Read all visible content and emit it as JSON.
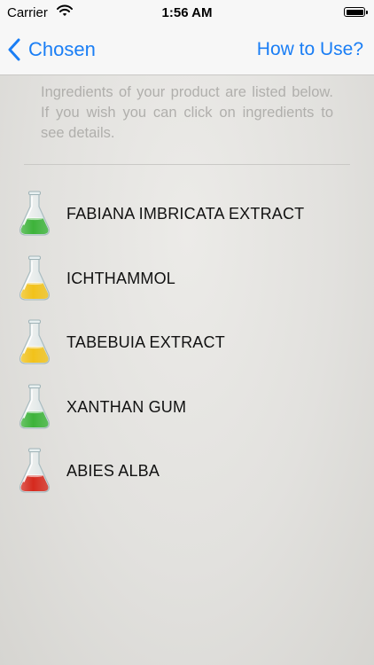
{
  "status_bar": {
    "carrier": "Carrier",
    "time": "1:56 AM",
    "wifi_icon": "wifi-icon",
    "battery_icon": "battery-icon"
  },
  "nav": {
    "back_label": "Chosen",
    "back_icon": "chevron-left-icon",
    "right_label": "How to Use?",
    "accent_color": "#1a7ef5"
  },
  "intro_text": "Ingredients of your product are listed below. If you wish you can click on ingredients to see details.",
  "ingredients": [
    {
      "name": "FABIANA IMBRICATA EXTRACT",
      "flask_color": "#3db33a",
      "icon": "flask-icon"
    },
    {
      "name": "ICHTHAMMOL",
      "flask_color": "#f2c21a",
      "icon": "flask-icon"
    },
    {
      "name": "TABEBUIA EXTRACT",
      "flask_color": "#f2c21a",
      "icon": "flask-icon"
    },
    {
      "name": "XANTHAN GUM",
      "flask_color": "#3db33a",
      "icon": "flask-icon"
    },
    {
      "name": "ABIES ALBA",
      "flask_color": "#d62a1e",
      "icon": "flask-icon"
    }
  ]
}
